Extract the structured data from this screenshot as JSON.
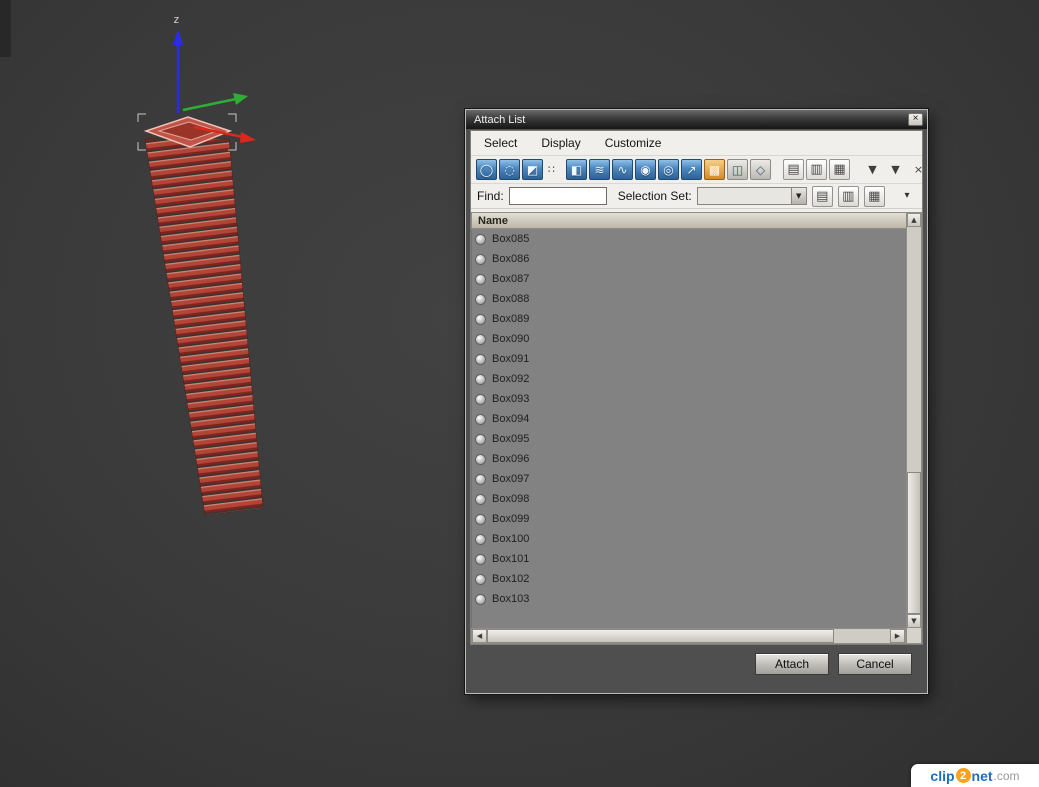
{
  "scene": {
    "axis": {
      "z": "z"
    }
  },
  "window": {
    "title": "Attach List",
    "close_glyph": "×",
    "menu": {
      "items": [
        "Select",
        "Display",
        "Customize"
      ]
    },
    "toolbar": {
      "icons": [
        {
          "name": "select-all-icon",
          "glyph": "◯"
        },
        {
          "name": "select-none-icon",
          "glyph": "◌"
        },
        {
          "name": "select-invert-icon",
          "glyph": "◩"
        },
        {
          "name": "select-children-icon",
          "glyph": "∷"
        },
        {
          "name": "display-geometry-icon",
          "glyph": "◧"
        },
        {
          "name": "display-spacewarps-icon",
          "glyph": "≋"
        },
        {
          "name": "display-shapes-icon",
          "glyph": "∿"
        },
        {
          "name": "display-lights-icon",
          "glyph": "◉"
        },
        {
          "name": "display-cameras-icon",
          "glyph": "◎"
        },
        {
          "name": "display-helpers-icon",
          "glyph": "↗"
        },
        {
          "name": "display-groups-icon",
          "glyph": "▩"
        },
        {
          "name": "display-xrefs-icon",
          "glyph": "◫"
        },
        {
          "name": "display-bones-icon",
          "glyph": "◇"
        },
        {
          "name": "view-list-icon",
          "glyph": "▤"
        },
        {
          "name": "view-detail-icon",
          "glyph": "▥"
        },
        {
          "name": "column-chooser-icon",
          "glyph": "▦"
        },
        {
          "name": "filter-icon",
          "glyph": "▼"
        },
        {
          "name": "custom-filter-icon",
          "glyph": "▼"
        },
        {
          "name": "clear-filter-icon",
          "glyph": "×"
        }
      ]
    },
    "find": {
      "label": "Find:",
      "value": "",
      "selection_set_label": "Selection Set:",
      "selection_set_value": "",
      "dropdown_glyph": "▼",
      "icons": [
        {
          "name": "edit-named-sets-icon",
          "glyph": "▤"
        },
        {
          "name": "add-to-set-icon",
          "glyph": "▥"
        },
        {
          "name": "remove-from-set-icon",
          "glyph": "▦"
        }
      ],
      "overflow_glyph": "▾"
    },
    "list": {
      "header": "Name",
      "items": [
        "Box085",
        "Box086",
        "Box087",
        "Box088",
        "Box089",
        "Box090",
        "Box091",
        "Box092",
        "Box093",
        "Box094",
        "Box095",
        "Box096",
        "Box097",
        "Box098",
        "Box099",
        "Box100",
        "Box101",
        "Box102",
        "Box103"
      ]
    },
    "scroll": {
      "up": "▲",
      "down": "▼",
      "left": "◀",
      "right": "▶"
    },
    "buttons": {
      "attach": "Attach",
      "cancel": "Cancel"
    }
  },
  "watermark": {
    "clip": "clip",
    "two": "2",
    "net": "net",
    "com": ".com"
  }
}
